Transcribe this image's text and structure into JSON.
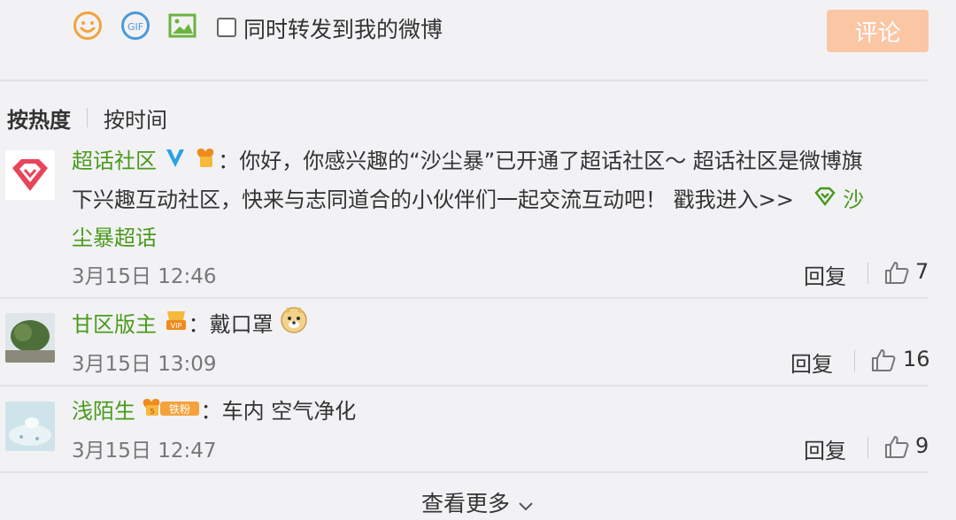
{
  "composer": {
    "repost_label": "同时转发到我的微博",
    "comment_button": "评论",
    "icons": [
      "smile-icon",
      "gif-icon",
      "image-icon"
    ],
    "accent_color": "#fbc6a4"
  },
  "sort": {
    "active": "按热度",
    "other": "按时间"
  },
  "comments": [
    {
      "name": "超话社区",
      "line1": "：你好，你感兴趣的“沙尘暴”已开通了超话社区～ 超话社区是微博旗",
      "line2": "下兴趣互动社区，快来与志同道合的小伙伴们一起交流互动吧！ 戳我进入>>",
      "link_part1": "沙",
      "link_part2": "尘暴超话",
      "time": "3月15日 12:46",
      "reply": "回复",
      "likes": "7"
    },
    {
      "name": "甘区版主",
      "text": "：戴口罩",
      "vip_badge": "VIP",
      "time": "3月15日 13:09",
      "reply": "回复",
      "likes": "16"
    },
    {
      "name": "浅陌生",
      "fan_badge": "铁粉",
      "fan_level": "5",
      "text": "：车内 空气净化",
      "time": "3月15日 12:47",
      "reply": "回复",
      "likes": "9"
    }
  ],
  "more_label": "查看更多",
  "colors": {
    "name_green": "#4a9a1c",
    "verified_blue": "#2ba1e6",
    "background": "#f2f2f5"
  }
}
